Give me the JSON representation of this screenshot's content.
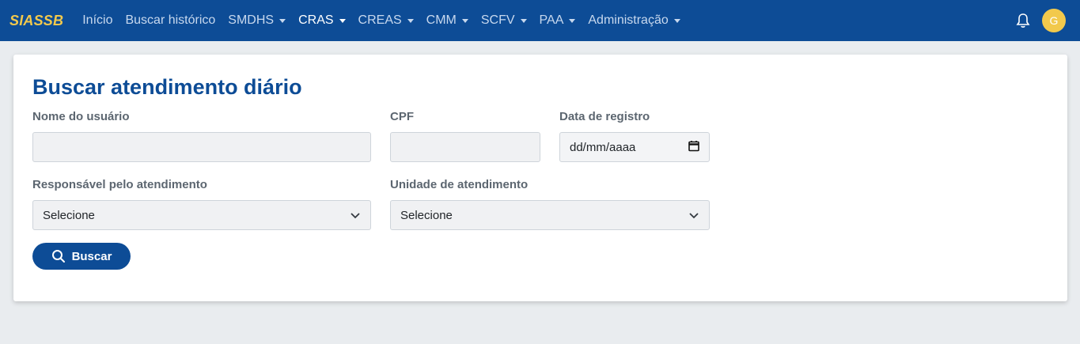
{
  "navbar": {
    "brand": "SIASSB",
    "items": [
      {
        "label": "Início",
        "dropdown": false,
        "active": false
      },
      {
        "label": "Buscar histórico",
        "dropdown": false,
        "active": false
      },
      {
        "label": "SMDHS",
        "dropdown": true,
        "active": false
      },
      {
        "label": "CRAS",
        "dropdown": true,
        "active": true
      },
      {
        "label": "CREAS",
        "dropdown": true,
        "active": false
      },
      {
        "label": "CMM",
        "dropdown": true,
        "active": false
      },
      {
        "label": "SCFV",
        "dropdown": true,
        "active": false
      },
      {
        "label": "PAA",
        "dropdown": true,
        "active": false
      },
      {
        "label": "Administração",
        "dropdown": true,
        "active": false
      }
    ],
    "notification_icon": "bell-icon",
    "avatar_initial": "G"
  },
  "form": {
    "title": "Buscar atendimento diário",
    "nome_label": "Nome do usuário",
    "nome_value": "",
    "cpf_label": "CPF",
    "cpf_value": "",
    "data_label": "Data de registro",
    "data_placeholder": "dd/mm/aaaa",
    "responsavel_label": "Responsável pelo atendimento",
    "responsavel_value": "Selecione",
    "unidade_label": "Unidade de atendimento",
    "unidade_value": "Selecione",
    "search_button": "Buscar"
  },
  "colors": {
    "navbar": "#0d4c96",
    "brand": "#f2c94c",
    "title": "#0d4c96",
    "background": "#e9ecef"
  }
}
